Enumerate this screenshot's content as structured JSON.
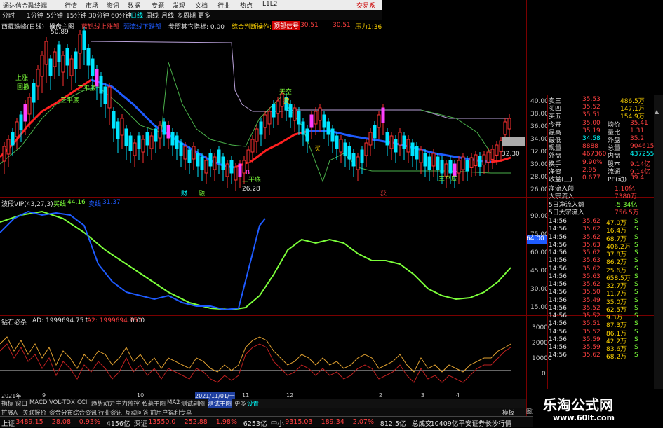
{
  "titlebar": {
    "app": "通达信金融终端",
    "menus": [
      "行情",
      "市场",
      "资讯",
      "数据",
      "专题",
      "发现",
      "文档",
      "行业",
      "热点",
      "L1L2"
    ],
    "right": "交易系"
  },
  "periods": [
    "分时",
    "1分钟",
    "5分钟",
    "15分钟",
    "30分钟",
    "60分钟",
    "日线",
    "周线",
    "月线",
    "多周期",
    "更多"
  ],
  "main_header": {
    "stock": "西藏珠峰(日线)",
    "ind": "操盘主图",
    "items": [
      "蓝钻线上涨部",
      "颈流线下跌部",
      "参照其它指标: 0.00",
      "综合判断操作: 0.00",
      "顶部信号",
      "30.51",
      "30.51",
      "压力1:36"
    ]
  },
  "price_labels": {
    "hi": "50.89",
    "lo": "26.28",
    "last": "32.30"
  },
  "chart_marks": [
    "三平底",
    "三平底",
    "三平底",
    "三平底",
    "天空",
    "上涨",
    "买",
    "回撤",
    "B",
    "卖",
    "获",
    "财",
    "融"
  ],
  "y_axis_main": [
    "40.00",
    "38.00",
    "36.00",
    "34.00",
    "32.00",
    "30.00",
    "28.00",
    "26.00"
  ],
  "ind1_header": {
    "name": "波段VIP(43,27,3)",
    "a": "买线",
    "a_val": "44.16",
    "b": "卖线",
    "b_val": "31.37"
  },
  "y_axis_ind1": [
    "90.00",
    "75.00",
    "60.00",
    "45.00",
    "30.00",
    "15.00"
  ],
  "ind1_tag": "64.00",
  "ind2_header": {
    "name": "钻石必杀",
    "a": "AD: 1999694.75↑",
    "b": "A2: 1999694.75↑",
    "c": "0.00"
  },
  "y_axis_ind2": [
    "30000",
    "20000",
    "10000",
    "0"
  ],
  "x_axis": [
    "2021年",
    "9",
    "10",
    "2021/11/01/一",
    "11",
    "12",
    "2",
    "3",
    "4"
  ],
  "quote": {
    "rows": [
      {
        "k": "卖三",
        "v": "35.53",
        "v2": "486.5万"
      },
      {
        "k": "买四",
        "v": "35.52",
        "v2": "147.1万"
      },
      {
        "k": "买五",
        "v": "35.51",
        "v2": "154.9万"
      },
      {
        "k": "今开",
        "v": "35.00",
        "k2": "均价",
        "v3": "35.41"
      },
      {
        "k": "最高",
        "v": "35.19",
        "k2": "量比",
        "v3": "1.31"
      },
      {
        "k": "最低",
        "v": "34.58",
        "k2": "外盘",
        "v3": "35.2"
      },
      {
        "k": "现量",
        "v": "8888",
        "k2": "总量",
        "v3": "904615"
      },
      {
        "k": "外盘",
        "v": "467360",
        "k2": "内盘",
        "v3": "437255"
      },
      {
        "k": "换手",
        "v": "9.90%",
        "k2": "股本",
        "v3": "9.14亿"
      },
      {
        "k": "净资",
        "v": "2.95",
        "k2": "流通",
        "v3": "9.14亿"
      },
      {
        "k": "收益(三)",
        "v": "0.677",
        "k2": "PE(动)",
        "v3": "39.4"
      }
    ],
    "flows": [
      {
        "k": "净流入额",
        "v": "1.10亿"
      },
      {
        "k": "大宗流入",
        "v": "7380万"
      },
      {
        "k": "5日净流入额",
        "v": "-5.34亿"
      },
      {
        "k": "5日大宗流入",
        "v": "756.5万"
      }
    ],
    "ticks": [
      [
        "14:56",
        "35.62",
        "47.0万",
        "S"
      ],
      [
        "14:56",
        "35.62",
        "16.4万",
        "S"
      ],
      [
        "14:56",
        "35.62",
        "68.7万",
        "S"
      ],
      [
        "14:56",
        "35.63",
        "406.2万",
        "S"
      ],
      [
        "14:56",
        "35.62",
        "37.8万",
        "S"
      ],
      [
        "14:56",
        "35.63",
        "86.2万",
        "S"
      ],
      [
        "14:56",
        "35.62",
        "25.6万",
        "S"
      ],
      [
        "14:56",
        "35.63",
        "658.5万",
        "S"
      ],
      [
        "14:56",
        "35.62",
        "32.7万",
        "S"
      ],
      [
        "14:56",
        "35.50",
        "11.7万",
        "S"
      ],
      [
        "14:56",
        "35.49",
        "35.0万",
        "S"
      ],
      [
        "14:56",
        "35.52",
        "62.5万",
        "S"
      ],
      [
        "14:56",
        "35.52",
        "9.3万",
        "S"
      ],
      [
        "14:56",
        "35.51",
        "87.3万",
        "S"
      ],
      [
        "14:56",
        "35.52",
        "86.1万",
        "S"
      ],
      [
        "14:56",
        "35.59",
        "42.2万",
        "S"
      ],
      [
        "14:56",
        "35.59",
        "83.6万",
        "S"
      ],
      [
        "14:56",
        "35.62",
        "68.2万",
        "S"
      ]
    ]
  },
  "bottom_tabs": [
    "指标",
    "窗口",
    "MACD",
    "VOL-TDX",
    "CCI",
    "趋势动力",
    "主力监控",
    "私募主图",
    "MA2",
    "测试副图",
    "测试主图",
    "更多",
    "设置"
  ],
  "bottom_tabs2": [
    "扩展A",
    "关联报价",
    "资金分布",
    "综合资讯",
    "行业资讯",
    "互动问答",
    "前用户福利专享"
  ],
  "status": [
    {
      "t": "上证",
      "c": "#ddd"
    },
    {
      "t": "3489.15",
      "c": "#ff4040"
    },
    {
      "t": "28.08",
      "c": "#ff4040"
    },
    {
      "t": "0.93%",
      "c": "#ff4040"
    },
    {
      "t": "4156亿",
      "c": "#ddd"
    },
    {
      "t": "深证",
      "c": "#ddd"
    },
    {
      "t": "13550.0",
      "c": "#ff4040"
    },
    {
      "t": "252.88",
      "c": "#ff4040"
    },
    {
      "t": "1.98%",
      "c": "#ff4040"
    },
    {
      "t": "6253亿",
      "c": "#ddd"
    },
    {
      "t": "中小",
      "c": "#ddd"
    },
    {
      "t": "9315.03",
      "c": "#ff4040"
    },
    {
      "t": "189.34",
      "c": "#ff4040"
    },
    {
      "t": "2.07%",
      "c": "#ff4040"
    },
    {
      "t": "812.5亿",
      "c": "#ddd"
    },
    {
      "t": "总成交",
      "c": "#ddd"
    },
    {
      "t": "10409亿平安证券长沙行情",
      "c": "#ddd"
    }
  ],
  "watermark": {
    "cn": "乐淘公式网",
    "url": "www.60lt.com"
  },
  "side_tab": "图文F10",
  "right_tab": "模板",
  "colors": {
    "up": "#ff4040",
    "down": "#00ffff",
    "blue": "#1e5bff",
    "green": "#7cff3a",
    "magenta": "#ff40ff"
  }
}
